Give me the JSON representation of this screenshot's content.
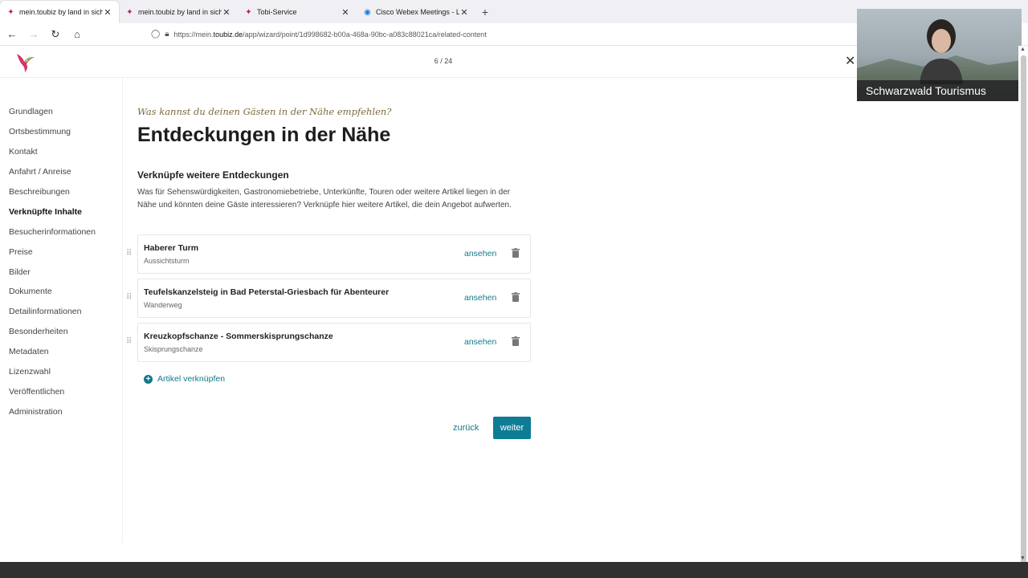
{
  "browser": {
    "tabs": [
      {
        "title": "mein.toubiz by land in sicht",
        "active": true
      },
      {
        "title": "mein.toubiz by land in sicht",
        "active": false
      },
      {
        "title": "Tobi-Service",
        "active": false
      },
      {
        "title": "Cisco Webex Meetings - Landing",
        "active": false
      }
    ],
    "url_prefix": "https://mein.",
    "url_domain": "toubiz.de",
    "url_path": "/app/wizard/point/1d998682-b00a-468a-90bc-a083c88021ca/related-content"
  },
  "header": {
    "progress": "6 / 24"
  },
  "sidebar": {
    "items": [
      {
        "label": "Grundlagen"
      },
      {
        "label": "Ortsbestimmung"
      },
      {
        "label": "Kontakt"
      },
      {
        "label": "Anfahrt / Anreise"
      },
      {
        "label": "Beschreibungen"
      },
      {
        "label": "Verknüpfte Inhalte",
        "active": true
      },
      {
        "label": "Besucherinformationen"
      },
      {
        "label": "Preise"
      },
      {
        "label": "Bilder"
      },
      {
        "label": "Dokumente"
      },
      {
        "label": "Detailinformationen"
      },
      {
        "label": "Besonderheiten"
      },
      {
        "label": "Metadaten"
      },
      {
        "label": "Lizenzwahl"
      },
      {
        "label": "Veröffentlichen"
      },
      {
        "label": "Administration"
      }
    ]
  },
  "main": {
    "eyebrow": "Was kannst du deinen Gästen in der Nähe empfehlen?",
    "title": "Entdeckungen in der Nähe",
    "subtitle": "Verknüpfe weitere Entdeckungen",
    "description": "Was für Sehenswürdigkeiten, Gastronomiebetriebe, Unterkünfte, Touren oder weitere Artikel liegen in der Nähe und könnten deine Gäste interessieren? Verknüpfe hier weitere Artikel, die dein Angebot aufwerten.",
    "items": [
      {
        "name": "Haberer Turm",
        "type": "Aussichtsturm",
        "view_label": "ansehen"
      },
      {
        "name": "Teufelskanzelsteig in Bad Peterstal-Griesbach für Abenteurer",
        "type": "Wanderweg",
        "view_label": "ansehen"
      },
      {
        "name": "Kreuzkopfschanze - Sommerskisprungschanze",
        "type": "Skisprungschanze",
        "view_label": "ansehen"
      }
    ],
    "add_label": "Artikel verknüpfen",
    "back_label": "zurück",
    "next_label": "weiter"
  },
  "video": {
    "participant": "Schwarzwald Tourismus"
  },
  "colors": {
    "accent": "#0f7c95",
    "link": "#117a8b",
    "eyebrow": "#7a6a3a"
  }
}
